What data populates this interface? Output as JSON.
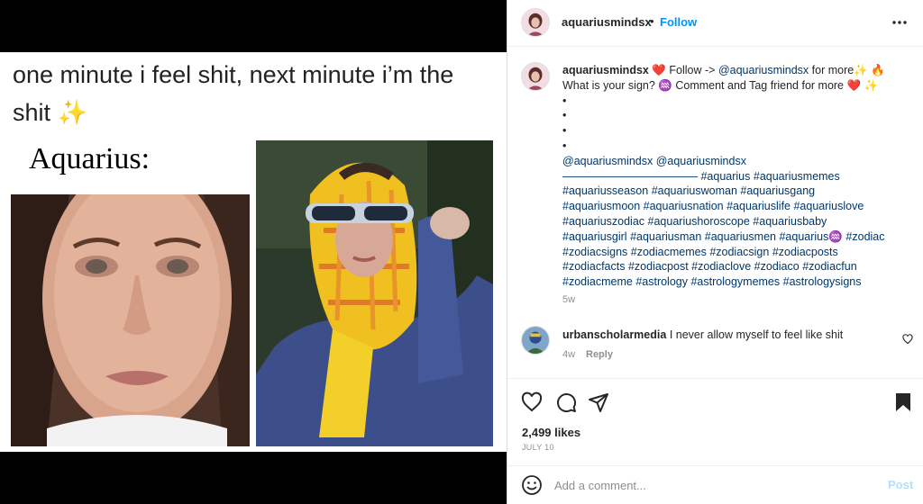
{
  "post": {
    "meme_caption_line1": "one minute i feel shit, next minute i’m the",
    "meme_caption_line2": "shit",
    "meme_sparkle": "✨",
    "panel_label": "Aquarius:"
  },
  "header": {
    "username": "aquariusmindsx",
    "separator": "•",
    "follow_label": "Follow",
    "more_icon": "more-horizontal-icon"
  },
  "caption": {
    "username": "aquariusmindsx",
    "heart_emoji": "❤️",
    "text1": " Follow -> ",
    "mention1": "@aquariusmindsx",
    "text2": " for more",
    "emoji_sparkle": "✨",
    "emoji_fire": "🔥",
    "line2_text": "What is your sign? ",
    "aquarius_emoji": "♒",
    "line2_text_b": " Comment and Tag friend for more ",
    "bullets": [
      "•",
      "•",
      "•",
      "•"
    ],
    "mention2": "@aquariusmindsx",
    "mention3": "@aquariusmindsx",
    "divider": "————————————",
    "hashtags_lines": [
      [
        "#aquarius",
        "#aquariusmemes"
      ],
      [
        "#aquariusseason",
        "#aquariuswoman",
        "#aquariusgang"
      ],
      [
        "#aquariusmoon",
        "#aquariusnation",
        "#aquariuslife",
        "#aquariuslove"
      ],
      [
        "#aquariuszodiac",
        "#aquariushoroscope",
        "#aquariusbaby"
      ],
      [
        "#aquariusgirl",
        "#aquariusman",
        "#aquariusmen",
        "#aquarius♒",
        "#zodiac"
      ],
      [
        "#zodiacsigns",
        "#zodiacmemes",
        "#zodiacsign",
        "#zodiacposts"
      ],
      [
        "#zodiacfacts",
        "#zodiacpost",
        "#zodiaclove",
        "#zodiaco",
        "#zodiacfun"
      ],
      [
        "#zodiacmeme",
        "#astrology",
        "#astrologymemes",
        "#astrologysigns"
      ]
    ],
    "time": "5w"
  },
  "comment": {
    "username": "urbanscholarmedia",
    "text": "I never allow myself to feel like shit",
    "time": "4w",
    "reply_label": "Reply"
  },
  "actions": {
    "icons": [
      "heart-icon",
      "comment-icon",
      "share-icon",
      "bookmark-icon"
    ],
    "likes": "2,499 likes",
    "date": "JULY 10"
  },
  "add_comment": {
    "placeholder": "Add a comment...",
    "post_label": "Post"
  },
  "colors": {
    "accent": "#0095f6",
    "link": "#00376b",
    "muted": "#8e8e8e",
    "post_disabled": "#b2dffc"
  }
}
